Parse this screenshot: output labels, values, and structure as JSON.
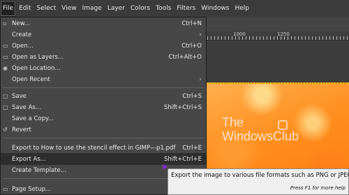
{
  "menubar": [
    "File",
    "Edit",
    "Select",
    "View",
    "Image",
    "Layer",
    "Colors",
    "Tools",
    "Filters",
    "Windows",
    "Help"
  ],
  "ruler": {
    "labels": [
      "1000",
      "1250"
    ]
  },
  "watermark": {
    "line1": "The",
    "line2": "WindowsClub"
  },
  "file_menu": [
    {
      "icon": "▫",
      "icon_name": "new-icon",
      "label": "New...",
      "shortcut": "Ctrl+N"
    },
    {
      "icon": "",
      "label": "Create",
      "submenu": "›"
    },
    {
      "icon": "▭",
      "icon_name": "open-icon",
      "label": "Open...",
      "shortcut": "Ctrl+O"
    },
    {
      "icon": "▭",
      "icon_name": "open-layers-icon",
      "label": "Open as Layers...",
      "shortcut": "Ctrl+Alt+O"
    },
    {
      "icon": "◉",
      "icon_name": "globe-icon",
      "label": "Open Location..."
    },
    {
      "icon": "",
      "label": "Open Recent",
      "submenu": "›"
    },
    {
      "icon": "▢",
      "icon_name": "save-icon",
      "label": "Save",
      "shortcut": "Ctrl+S"
    },
    {
      "icon": "▢",
      "icon_name": "save-as-icon",
      "label": "Save As...",
      "shortcut": "Shift+Ctrl+S"
    },
    {
      "icon": "",
      "label": "Save a Copy..."
    },
    {
      "icon": "↺",
      "icon_name": "revert-icon",
      "label": "Revert"
    },
    {
      "icon": "",
      "label": "Export to How to use the stencil effect in GIMP---p1.pdf",
      "shortcut": "Ctrl+E"
    },
    {
      "icon": "",
      "label": "Export As...",
      "shortcut": "Shift+Ctrl+E"
    },
    {
      "icon": "",
      "label": "Create Template..."
    },
    {
      "icon": "▭",
      "icon_name": "page-setup-icon",
      "label": "Page Setup..."
    }
  ],
  "tooltip": {
    "text": "Export the image to various file formats such as PNG or JPEG",
    "hint": "Press F1 for more help"
  }
}
